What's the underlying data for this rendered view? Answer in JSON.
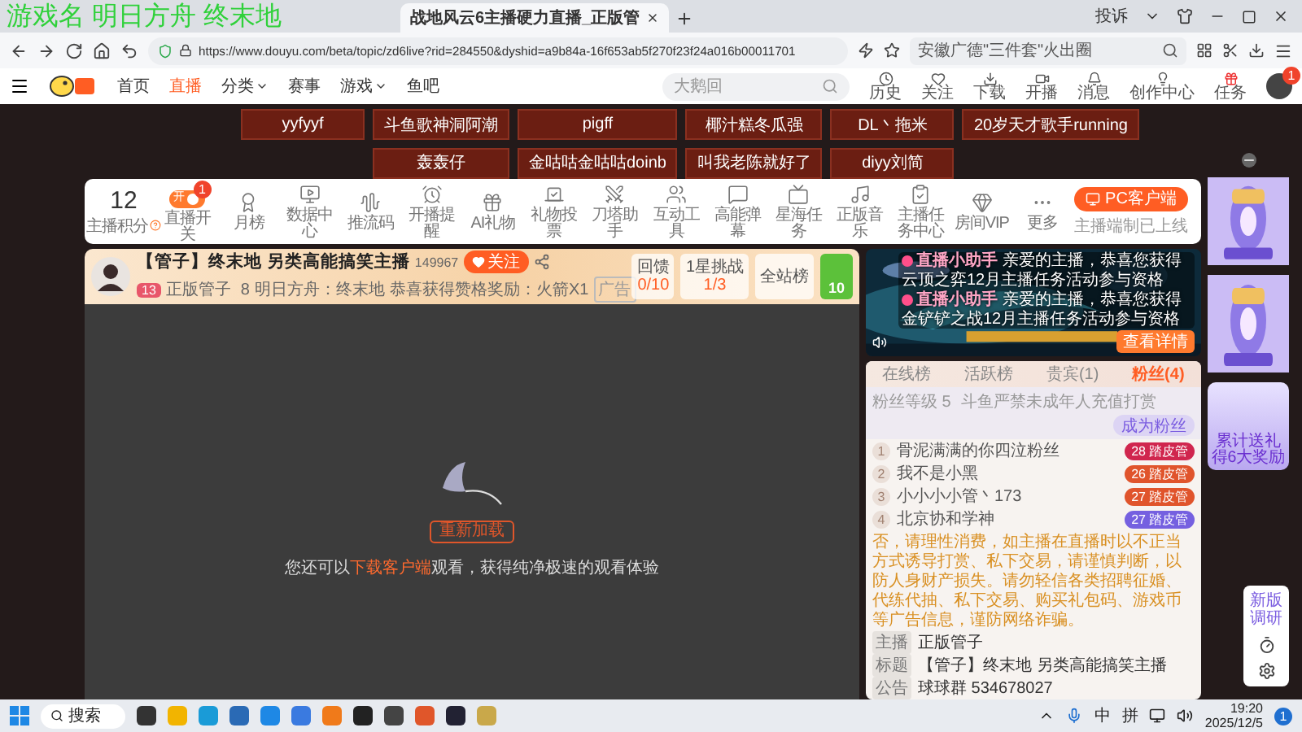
{
  "overlay_caption": "游戏名 明日方舟 终末地",
  "browser": {
    "tabs": [
      {
        "label": "战地风云6主播硬力直播_正版管",
        "selected": true
      }
    ],
    "report": "投诉",
    "url": "https://www.douyu.com/beta/topic/zd6live?rid=284550&dyshid=a9b84a-16f653ab5f270f23f24a016b00011701",
    "search_placeholder": "安徽广德\"三件套\"火出圈"
  },
  "site_nav": {
    "menu": [
      {
        "label": "首页",
        "selected": false,
        "dropdown": false
      },
      {
        "label": "直播",
        "selected": true,
        "dropdown": false
      },
      {
        "label": "分类",
        "selected": false,
        "dropdown": true
      },
      {
        "label": "赛事",
        "selected": false,
        "dropdown": false
      },
      {
        "label": "游戏",
        "selected": false,
        "dropdown": true
      },
      {
        "label": "鱼吧",
        "selected": false,
        "dropdown": false
      }
    ],
    "search": {
      "placeholder": "大鹅回"
    },
    "actions": [
      {
        "label": "历史"
      },
      {
        "label": "关注"
      },
      {
        "label": "下载"
      },
      {
        "label": "开播"
      },
      {
        "label": "消息"
      },
      {
        "label": "创作中心"
      },
      {
        "label": "任务"
      }
    ],
    "avatar_badge": "1"
  },
  "tags": [
    [
      "yyfyyf",
      "斗鱼歌神洞阿潮",
      "pigff",
      "椰汁糕冬瓜强",
      "DL丶拖米",
      "20岁天才歌手running"
    ],
    [
      "轰轰仔",
      "金咕咕金咕咕doinb",
      "叫我老陈就好了",
      "diyy刘简"
    ]
  ],
  "toolbar": {
    "score": "12",
    "score_label": "主播积分",
    "tools": [
      {
        "kind": "toggle",
        "label": "直播开关",
        "on": true,
        "toggle_text": "开",
        "badge": "1"
      },
      {
        "kind": "tool",
        "label": "月榜"
      },
      {
        "kind": "tool",
        "label": "数据中心"
      },
      {
        "kind": "tool",
        "label": "推流码"
      },
      {
        "kind": "tool",
        "label": "开播提醒"
      },
      {
        "kind": "tool",
        "label": "AI礼物"
      },
      {
        "kind": "tool",
        "label": "礼物投票"
      },
      {
        "kind": "tool",
        "label": "刀塔助手"
      },
      {
        "kind": "tool",
        "label": "互动工具"
      },
      {
        "kind": "tool",
        "label": "高能弹幕"
      },
      {
        "kind": "tool",
        "label": "星海任务"
      },
      {
        "kind": "tool",
        "label": "正版音乐"
      },
      {
        "kind": "tool",
        "label": "主播任务中心"
      },
      {
        "kind": "tool",
        "label": "房间VIP"
      },
      {
        "kind": "tool",
        "label": "更多"
      }
    ],
    "client_button": "PC客户端",
    "client_note": "主播端制已上线"
  },
  "stream": {
    "title": "【管子】终末地 另类高能搞笑主播",
    "viewers": "149967",
    "follow": "关注",
    "level": "13",
    "streamer": "正版管子",
    "hot": "8",
    "category": "明日方舟：终末地",
    "reward": "恭喜获得赞格奖励：火箭X1",
    "ad": "广告",
    "tasks": [
      {
        "label": "回馈",
        "value": "0/10"
      },
      {
        "label": "1星挑战",
        "value": "1/3"
      }
    ],
    "board": "全站榜",
    "gift_count": "10"
  },
  "player": {
    "reload": "重新加载",
    "hint_before": "您还可以",
    "hint_link": "下载客户端",
    "hint_after": "观看，获得纯净极速的观看体验"
  },
  "promo": {
    "messages": [
      {
        "sender": "直播小助手",
        "text": "亲爱的主播，恭喜您获得云顶之弈12月主播任务活动参与资格"
      },
      {
        "sender": "直播小助手",
        "text": "亲爱的主播，恭喜您获得金铲铲之战12月主播任务活动参与资格"
      }
    ],
    "button": "查看详情"
  },
  "ranking": {
    "tabs": [
      {
        "label": "在线榜",
        "selected": false
      },
      {
        "label": "活跃榜",
        "selected": false
      },
      {
        "label": "贵宾(1)",
        "selected": false
      },
      {
        "label": "粉丝(4)",
        "selected": true
      }
    ],
    "fan_level": "粉丝等级 5",
    "notice": "斗鱼严禁未成年人充值打赏",
    "join": "成为粉丝",
    "rows": [
      {
        "rank": "1",
        "name": "骨泥满满的你四泣粉丝",
        "badge_level": "28",
        "badge": "踏皮管",
        "color": "#d0264e"
      },
      {
        "rank": "2",
        "name": "我不是小黑",
        "badge_level": "26",
        "badge": "踏皮管",
        "color": "#e0542c"
      },
      {
        "rank": "3",
        "name": "小小小小管丶173",
        "badge_level": "27",
        "badge": "踏皮管",
        "color": "#e0542c"
      },
      {
        "rank": "4",
        "name": "北京协和学神",
        "badge_level": "27",
        "badge": "踏皮管",
        "color": "#7560e0"
      }
    ]
  },
  "chat": {
    "warning": "否，请理性消费，如主播在直播时以不正当方式诱导打赏、私下交易，请谨慎判断，以防人身财产损失。请勿轻信各类招聘征婚、代练代抽、私下交易、购买礼包码、游戏币等广告信息，谨防网络诈骗。",
    "info": [
      {
        "label": "主播",
        "value": "正版管子"
      },
      {
        "label": "标题",
        "value": "【管子】终末地 另类高能搞笑主播"
      },
      {
        "label": "公告",
        "value": "球球群 534678027"
      }
    ]
  },
  "side": {
    "gift_lines": [
      "累计送礼",
      "得6大奖励"
    ],
    "survey": "新版调研"
  },
  "taskbar": {
    "search": "搜索",
    "tray": [
      "中",
      "拼"
    ],
    "time": "19:20",
    "date": "2025/12/5",
    "notifications": "1"
  }
}
